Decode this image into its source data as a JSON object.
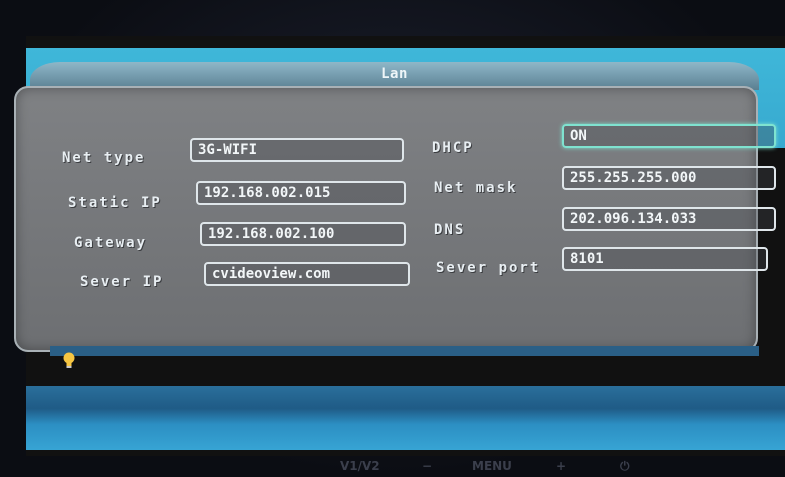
{
  "dialog": {
    "title": "Lan"
  },
  "fields": {
    "net_type": {
      "label": "Net type",
      "value": "3G-WIFI"
    },
    "static_ip": {
      "label": "Static IP",
      "value": "192.168.002.015"
    },
    "gateway": {
      "label": "Gateway",
      "value": "192.168.002.100"
    },
    "sever_ip": {
      "label": "Sever IP",
      "value": "cvideoview.com"
    },
    "dhcp": {
      "label": "DHCP",
      "value": "ON"
    },
    "net_mask": {
      "label": "Net mask",
      "value": "255.255.255.000"
    },
    "dns": {
      "label": "DNS",
      "value": "202.096.134.033"
    },
    "sever_port": {
      "label": "Sever port",
      "value": "8101"
    }
  },
  "monitor_buttons": {
    "v1v2": "V1/V2",
    "minus": "−",
    "menu": "MENU",
    "plus": "+",
    "power": "⏻"
  },
  "colors": {
    "top_band": "#3fb7d9",
    "dialog_body": "#7f8184",
    "focus_border": "#7fe3d0",
    "hint_icon": "#f5c542"
  },
  "icons": {
    "hint": "lightbulb-icon",
    "power": "power-icon"
  }
}
